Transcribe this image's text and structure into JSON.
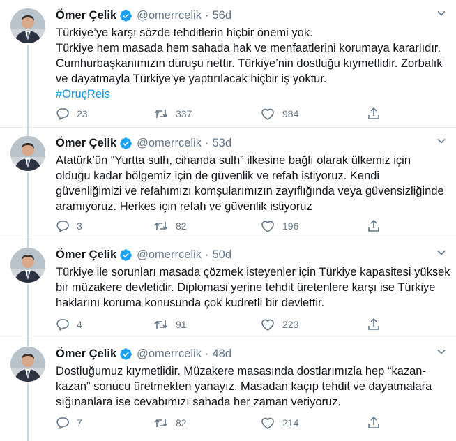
{
  "tweets": [
    {
      "name": "Ömer Çelik",
      "handle": "@omerrcelik",
      "time": "56d",
      "lines": [
        "Türkiye’ye karşı sözde tehditlerin hiçbir önemi yok.",
        "Türkiye hem masada hem sahada hak ve menfaatlerini korumaya kararlıdır.",
        "Cumhurbaşkanımızın duruşu nettir. Türkiye’nin dostluğu kıymetlidir. Zorbalık",
        "ve dayatmayla Türkiye’ye yaptırılacak hiçbir iş yoktur."
      ],
      "hashtag": "#OruçReis",
      "replies": "23",
      "retweets": "337",
      "likes": "984"
    },
    {
      "name": "Ömer Çelik",
      "handle": "@omerrcelik",
      "time": "53d",
      "lines": [
        "Atatürk’ün “Yurtta sulh, cihanda sulh” ilkesine bağlı olarak ülkemiz için",
        "olduğu kadar bölgemiz için de güvenlik ve refah istiyoruz. Kendi",
        "güvenliğimizi ve refahımızı komşularımızın zayıflığında veya güvensizliğinde",
        "aramıyoruz. Herkes için refah ve güvenlik istiyoruz"
      ],
      "replies": "3",
      "retweets": "82",
      "likes": "196"
    },
    {
      "name": "Ömer Çelik",
      "handle": "@omerrcelik",
      "time": "50d",
      "lines": [
        "Türkiye ile sorunları masada çözmek isteyenler için Türkiye kapasitesi yüksek",
        "bir müzakere devletidir. Diplomasi yerine tehdit üretenlere karşı ise Türkiye",
        "haklarını koruma konusunda çok kudretli bir devlettir."
      ],
      "replies": "4",
      "retweets": "91",
      "likes": "223"
    },
    {
      "name": "Ömer Çelik",
      "handle": "@omerrcelik",
      "time": "48d",
      "lines": [
        "Dostluğumuz kıymetlidir. Müzakere masasında dostlarımızla hep “kazan-",
        "kazan” sonucu üretmekten yanayız. Masadan kaçıp tehdit  ve dayatmalara",
        "sığınanlara ise cevabımızı sahada her zaman veriyoruz."
      ],
      "replies": "7",
      "retweets": "82",
      "likes": "214"
    }
  ],
  "colors": {
    "text": "#14171a",
    "secondary": "#657786",
    "hashtag": "#1b95e0",
    "verified": "#1da1f2",
    "thread_line": "#ccd6dd"
  },
  "icons": [
    "verified-badge-icon",
    "caret-down-icon",
    "reply-icon",
    "retweet-icon",
    "like-icon",
    "share-icon"
  ]
}
